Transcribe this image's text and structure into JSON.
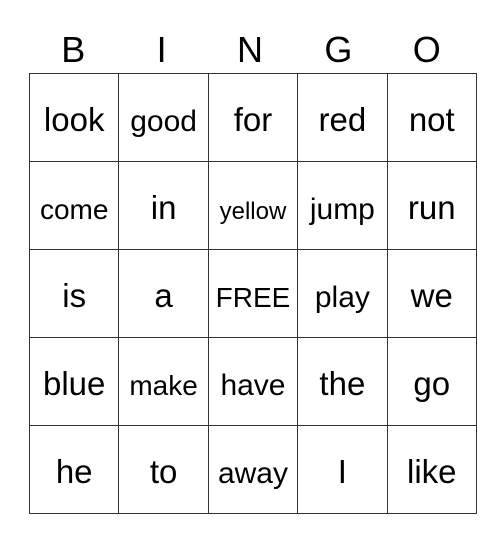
{
  "card": {
    "header": [
      "B",
      "I",
      "N",
      "G",
      "O"
    ],
    "rows": [
      [
        "look",
        "good",
        "for",
        "red",
        "not"
      ],
      [
        "come",
        "in",
        "yellow",
        "jump",
        "run"
      ],
      [
        "is",
        "a",
        "FREE",
        "play",
        "we"
      ],
      [
        "blue",
        "make",
        "have",
        "the",
        "go"
      ],
      [
        "he",
        "to",
        "away",
        "I",
        "like"
      ]
    ],
    "free_space_label": "FREE"
  }
}
